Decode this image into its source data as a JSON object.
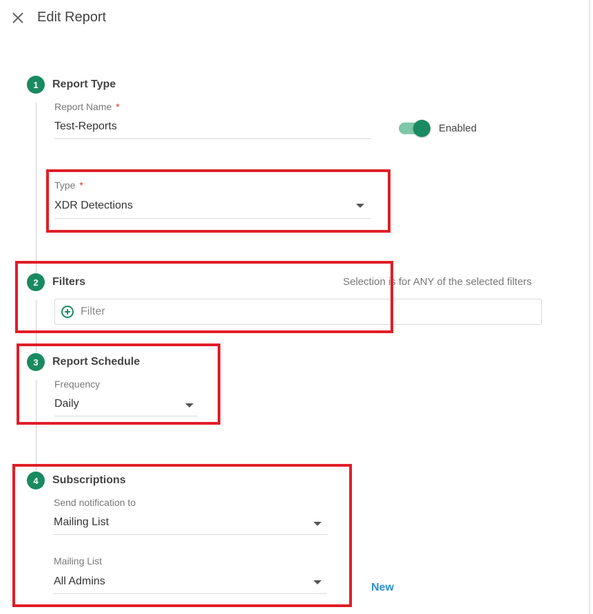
{
  "header": {
    "title": "Edit Report",
    "close_icon": "close-icon"
  },
  "steps": {
    "report_type": {
      "number": "1",
      "title": "Report Type",
      "name_label": "Report Name",
      "required_mark": "*",
      "name_value": "Test-Reports",
      "toggle_label": "Enabled",
      "toggle_on": true,
      "type_label": "Type",
      "type_value": "XDR Detections"
    },
    "filters": {
      "number": "2",
      "title": "Filters",
      "hint": "Selection is for ANY of the selected filters",
      "placeholder": "Filter",
      "add_icon": "plus-circle-icon"
    },
    "schedule": {
      "number": "3",
      "title": "Report Schedule",
      "frequency_label": "Frequency",
      "frequency_value": "Daily"
    },
    "subscriptions": {
      "number": "4",
      "title": "Subscriptions",
      "send_label": "Send notification to",
      "send_value": "Mailing List",
      "list_label": "Mailing List",
      "list_value": "All Admins",
      "new_label": "New"
    }
  },
  "colors": {
    "accent": "#1a8a60",
    "toggle_track": "#7cc8a8",
    "required": "#e0302b",
    "link": "#2b8fd6",
    "highlight": "#e01e27"
  }
}
